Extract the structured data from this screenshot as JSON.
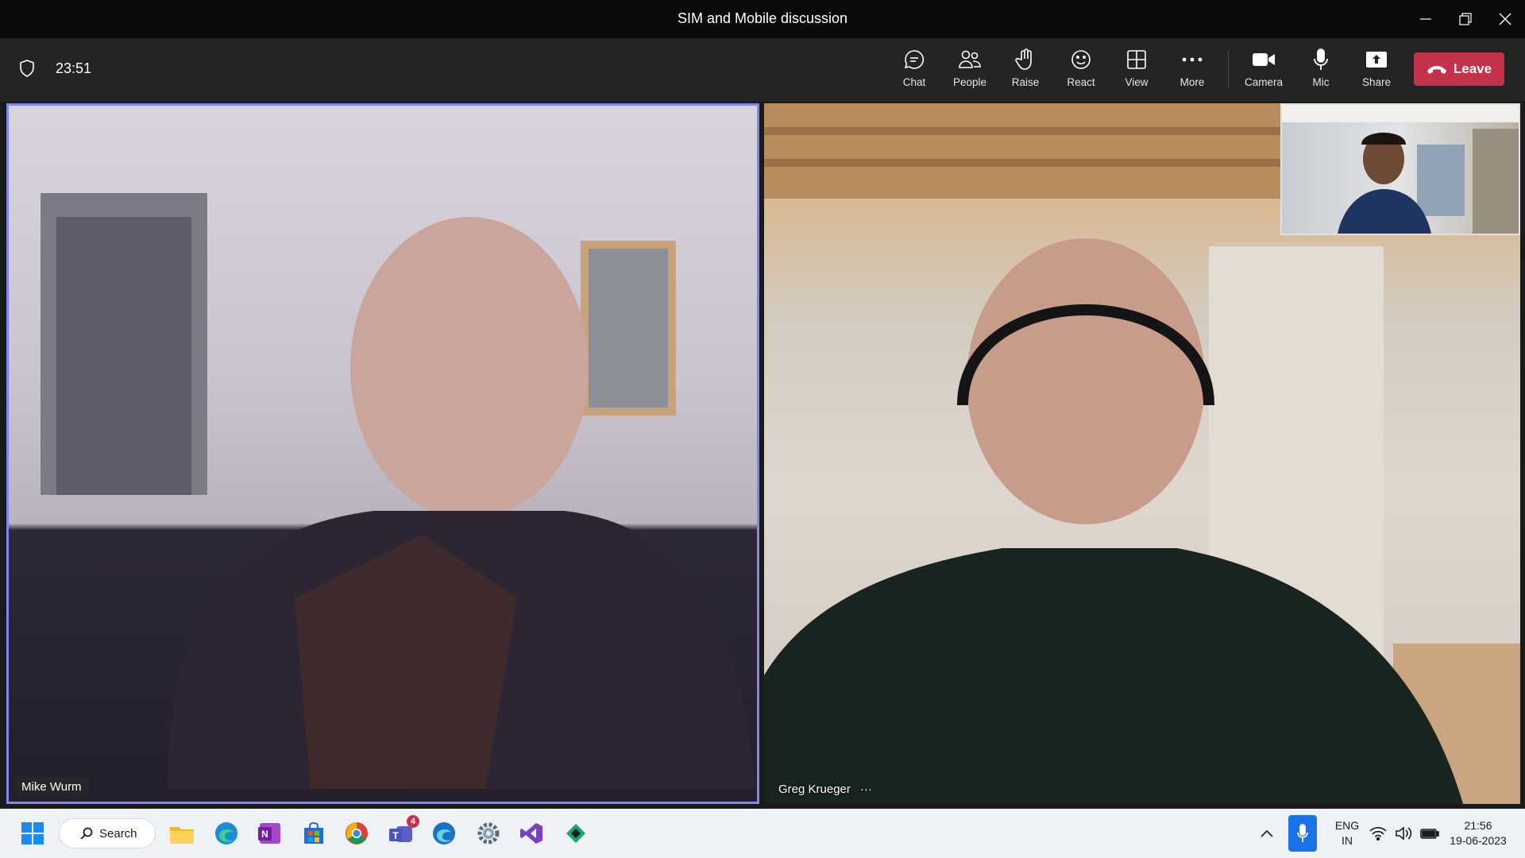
{
  "window": {
    "title": "SIM and Mobile discussion"
  },
  "meeting": {
    "timer": "23:51"
  },
  "toolbar": {
    "chat": "Chat",
    "people": "People",
    "raise": "Raise",
    "react": "React",
    "view": "View",
    "more": "More",
    "camera": "Camera",
    "mic": "Mic",
    "share": "Share",
    "leave": "Leave"
  },
  "participants": [
    {
      "name": "Mike Wurm"
    },
    {
      "name": "Greg Krueger",
      "more": "···"
    }
  ],
  "colors": {
    "accent": "#7f85f5",
    "leave": "#c4314b",
    "taskbar": "#eef1f6"
  },
  "taskbar": {
    "search": "Search",
    "apps": [
      "windows-icon",
      "file-explorer-icon",
      "edge-icon",
      "onenote-icon",
      "store-icon",
      "chrome-icon",
      "teams-icon",
      "edge-beta-icon",
      "settings-icon",
      "visual-studio-icon",
      "snipping-icon"
    ],
    "teams_badge": "4",
    "lang": "ENG",
    "region": "IN",
    "time": "21:56",
    "date": "19-06-2023"
  }
}
